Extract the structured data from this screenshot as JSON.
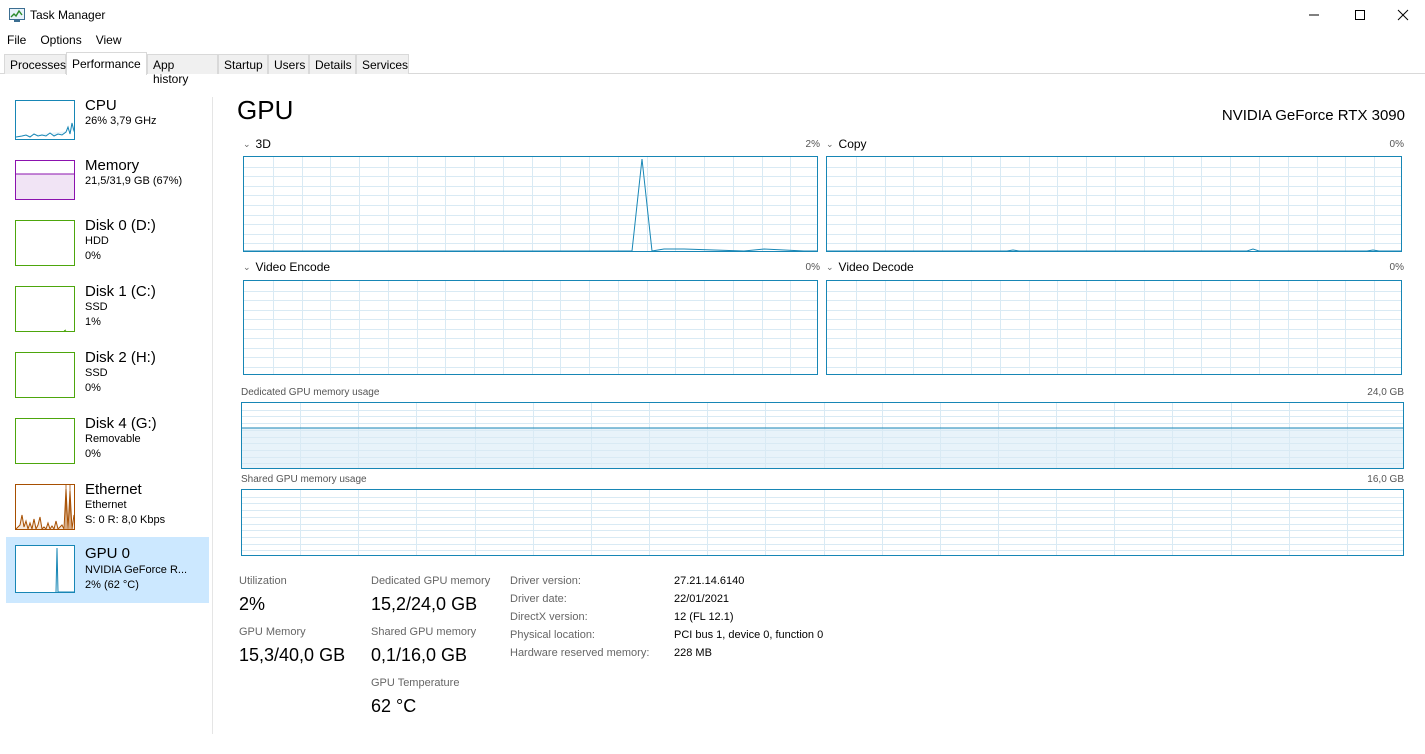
{
  "window": {
    "title": "Task Manager",
    "minimize_icon": "minimize-icon",
    "maximize_icon": "maximize-icon",
    "close_icon": "close-icon"
  },
  "menu": [
    "File",
    "Options",
    "View"
  ],
  "tabs": [
    "Processes",
    "Performance",
    "App history",
    "Startup",
    "Users",
    "Details",
    "Services"
  ],
  "active_tab": "Performance",
  "sidebar": [
    {
      "title": "CPU",
      "lines": [
        "26%  3,79 GHz"
      ],
      "color": "#1786b5"
    },
    {
      "title": "Memory",
      "lines": [
        "21,5/31,9 GB (67%)"
      ],
      "color": "#8b12ae"
    },
    {
      "title": "Disk 0 (D:)",
      "lines": [
        "HDD",
        "0%"
      ],
      "color": "#4da60c"
    },
    {
      "title": "Disk 1 (C:)",
      "lines": [
        "SSD",
        "1%"
      ],
      "color": "#4da60c"
    },
    {
      "title": "Disk 2 (H:)",
      "lines": [
        "SSD",
        "0%"
      ],
      "color": "#4da60c"
    },
    {
      "title": "Disk 4 (G:)",
      "lines": [
        "Removable",
        "0%"
      ],
      "color": "#4da60c"
    },
    {
      "title": "Ethernet",
      "lines": [
        "Ethernet",
        "S: 0  R: 8,0 Kbps"
      ],
      "color": "#a74f01"
    },
    {
      "title": "GPU 0",
      "lines": [
        "NVIDIA GeForce R...",
        "2% (62 °C)"
      ],
      "color": "#1786b5"
    }
  ],
  "main": {
    "title": "GPU",
    "model": "NVIDIA GeForce RTX 3090",
    "engines": [
      {
        "name": "3D",
        "percent": "2%"
      },
      {
        "name": "Copy",
        "percent": "0%"
      },
      {
        "name": "Video Encode",
        "percent": "0%"
      },
      {
        "name": "Video Decode",
        "percent": "0%"
      }
    ],
    "dedicated_label": "Dedicated GPU memory usage",
    "dedicated_max": "24,0 GB",
    "shared_label": "Shared GPU memory usage",
    "shared_max": "16,0 GB"
  },
  "stats": {
    "utilization_label": "Utilization",
    "utilization": "2%",
    "dedicated_label": "Dedicated GPU memory",
    "dedicated": "15,2/24,0 GB",
    "gpu_memory_label": "GPU Memory",
    "gpu_memory": "15,3/40,0 GB",
    "shared_label": "Shared GPU memory",
    "shared": "0,1/16,0 GB",
    "temp_label": "GPU Temperature",
    "temp": "62 °C"
  },
  "properties": [
    {
      "label": "Driver version:",
      "value": "27.21.14.6140"
    },
    {
      "label": "Driver date:",
      "value": "22/01/2021"
    },
    {
      "label": "DirectX version:",
      "value": "12 (FL 12.1)"
    },
    {
      "label": "Physical location:",
      "value": "PCI bus 1, device 0, function 0"
    },
    {
      "label": "Hardware reserved memory:",
      "value": "228 MB"
    }
  ],
  "accent_color": "#1786b5",
  "selection_color": "#cce8ff"
}
